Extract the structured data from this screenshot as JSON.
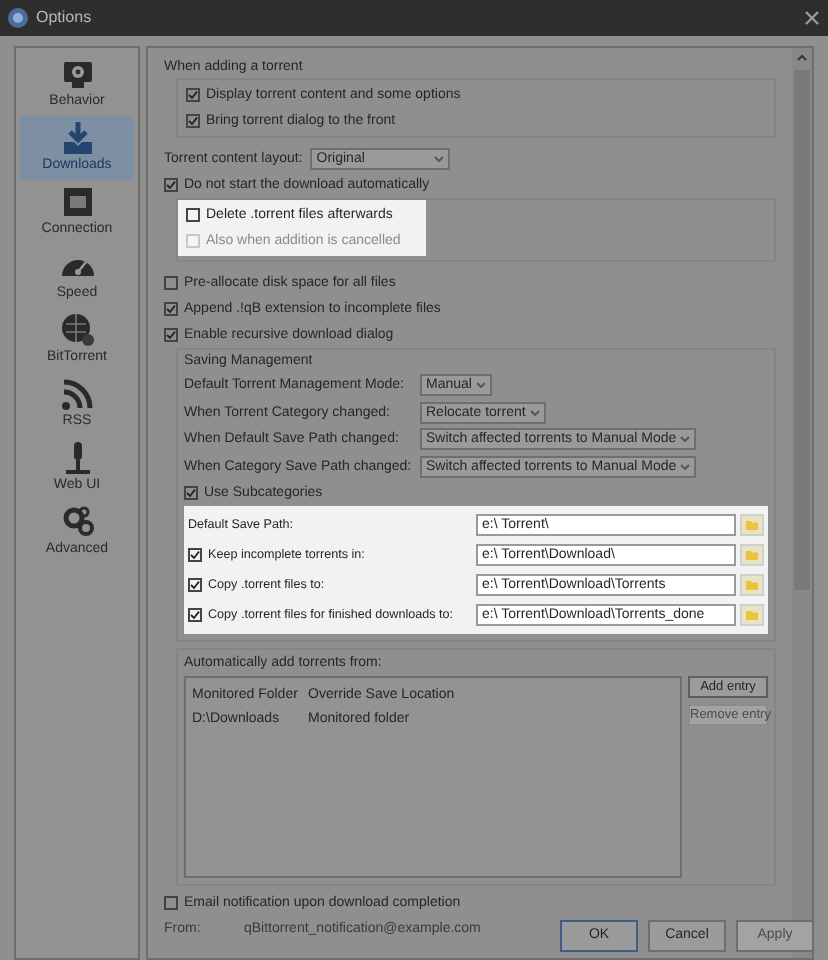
{
  "window": {
    "title": "Options"
  },
  "sidebar": {
    "items": [
      {
        "label": "Behavior",
        "selected": false
      },
      {
        "label": "Downloads",
        "selected": true
      },
      {
        "label": "Connection",
        "selected": false
      },
      {
        "label": "Speed",
        "selected": false
      },
      {
        "label": "BitTorrent",
        "selected": false
      },
      {
        "label": "RSS",
        "selected": false
      },
      {
        "label": "Web UI",
        "selected": false
      },
      {
        "label": "Advanced",
        "selected": false
      }
    ]
  },
  "adding_group": {
    "title": "When adding a torrent",
    "checkboxes": [
      {
        "label": "Display torrent content and some options",
        "checked": true
      },
      {
        "label": "Bring torrent dialog to the front",
        "checked": true
      }
    ]
  },
  "content_layout": {
    "label": "Torrent content layout:",
    "value": "Original"
  },
  "do_not_start": {
    "label": "Do not start the download automatically",
    "checked": true
  },
  "delete_group": {
    "highlighted": true,
    "checkboxes": [
      {
        "label": "Delete .torrent files afterwards",
        "checked": false,
        "disabled": false
      },
      {
        "label": "Also when addition is cancelled",
        "checked": false,
        "disabled": true
      }
    ]
  },
  "options": [
    {
      "label": "Pre-allocate disk space for all files",
      "checked": false
    },
    {
      "label": "Append .!qB extension to incomplete files",
      "checked": true
    },
    {
      "label": "Enable recursive download dialog",
      "checked": true
    }
  ],
  "saving_management": {
    "title": "Saving Management",
    "dropdowns": [
      {
        "label": "Default Torrent Management Mode:",
        "value": "Manual"
      },
      {
        "label": "When Torrent Category changed:",
        "value": "Relocate torrent"
      },
      {
        "label": "When Default Save Path changed:",
        "value": "Switch affected torrents to Manual Mode"
      },
      {
        "label": "When Category Save Path changed:",
        "value": "Switch affected torrents to Manual Mode"
      }
    ],
    "use_subcategories": {
      "label": "Use Subcategories",
      "checked": true
    },
    "paths": {
      "highlighted": true,
      "rows": [
        {
          "kind": "label",
          "label": "Default Save Path:",
          "value": "e:\\ Torrent\\"
        },
        {
          "kind": "checkbox",
          "label": "Keep incomplete torrents in:",
          "checked": true,
          "value": "e:\\ Torrent\\Download\\"
        },
        {
          "kind": "checkbox",
          "label": "Copy .torrent files to:",
          "checked": true,
          "value": "e:\\ Torrent\\Download\\Torrents"
        },
        {
          "kind": "checkbox",
          "label": "Copy .torrent files for finished downloads to:",
          "checked": true,
          "value": "e:\\ Torrent\\Download\\Torrents_done"
        }
      ]
    }
  },
  "auto_add": {
    "title": "Automatically add torrents from:",
    "columns": [
      "Monitored Folder",
      "Override Save Location"
    ],
    "rows": [
      [
        "D:\\Downloads",
        "Monitored folder"
      ]
    ],
    "buttons": [
      {
        "label": "Add entry",
        "disabled": false
      },
      {
        "label": "Remove entry",
        "disabled": true
      }
    ]
  },
  "email": {
    "label": "Email notification upon download completion",
    "checked": false,
    "from_label": "From:",
    "from_value": "qBittorrent_notification@example.com",
    "disabled": true
  },
  "buttons": [
    {
      "label": "OK",
      "default": true,
      "disabled": false
    },
    {
      "label": "Cancel",
      "default": false,
      "disabled": false
    },
    {
      "label": "Apply",
      "default": false,
      "disabled": true
    }
  ]
}
